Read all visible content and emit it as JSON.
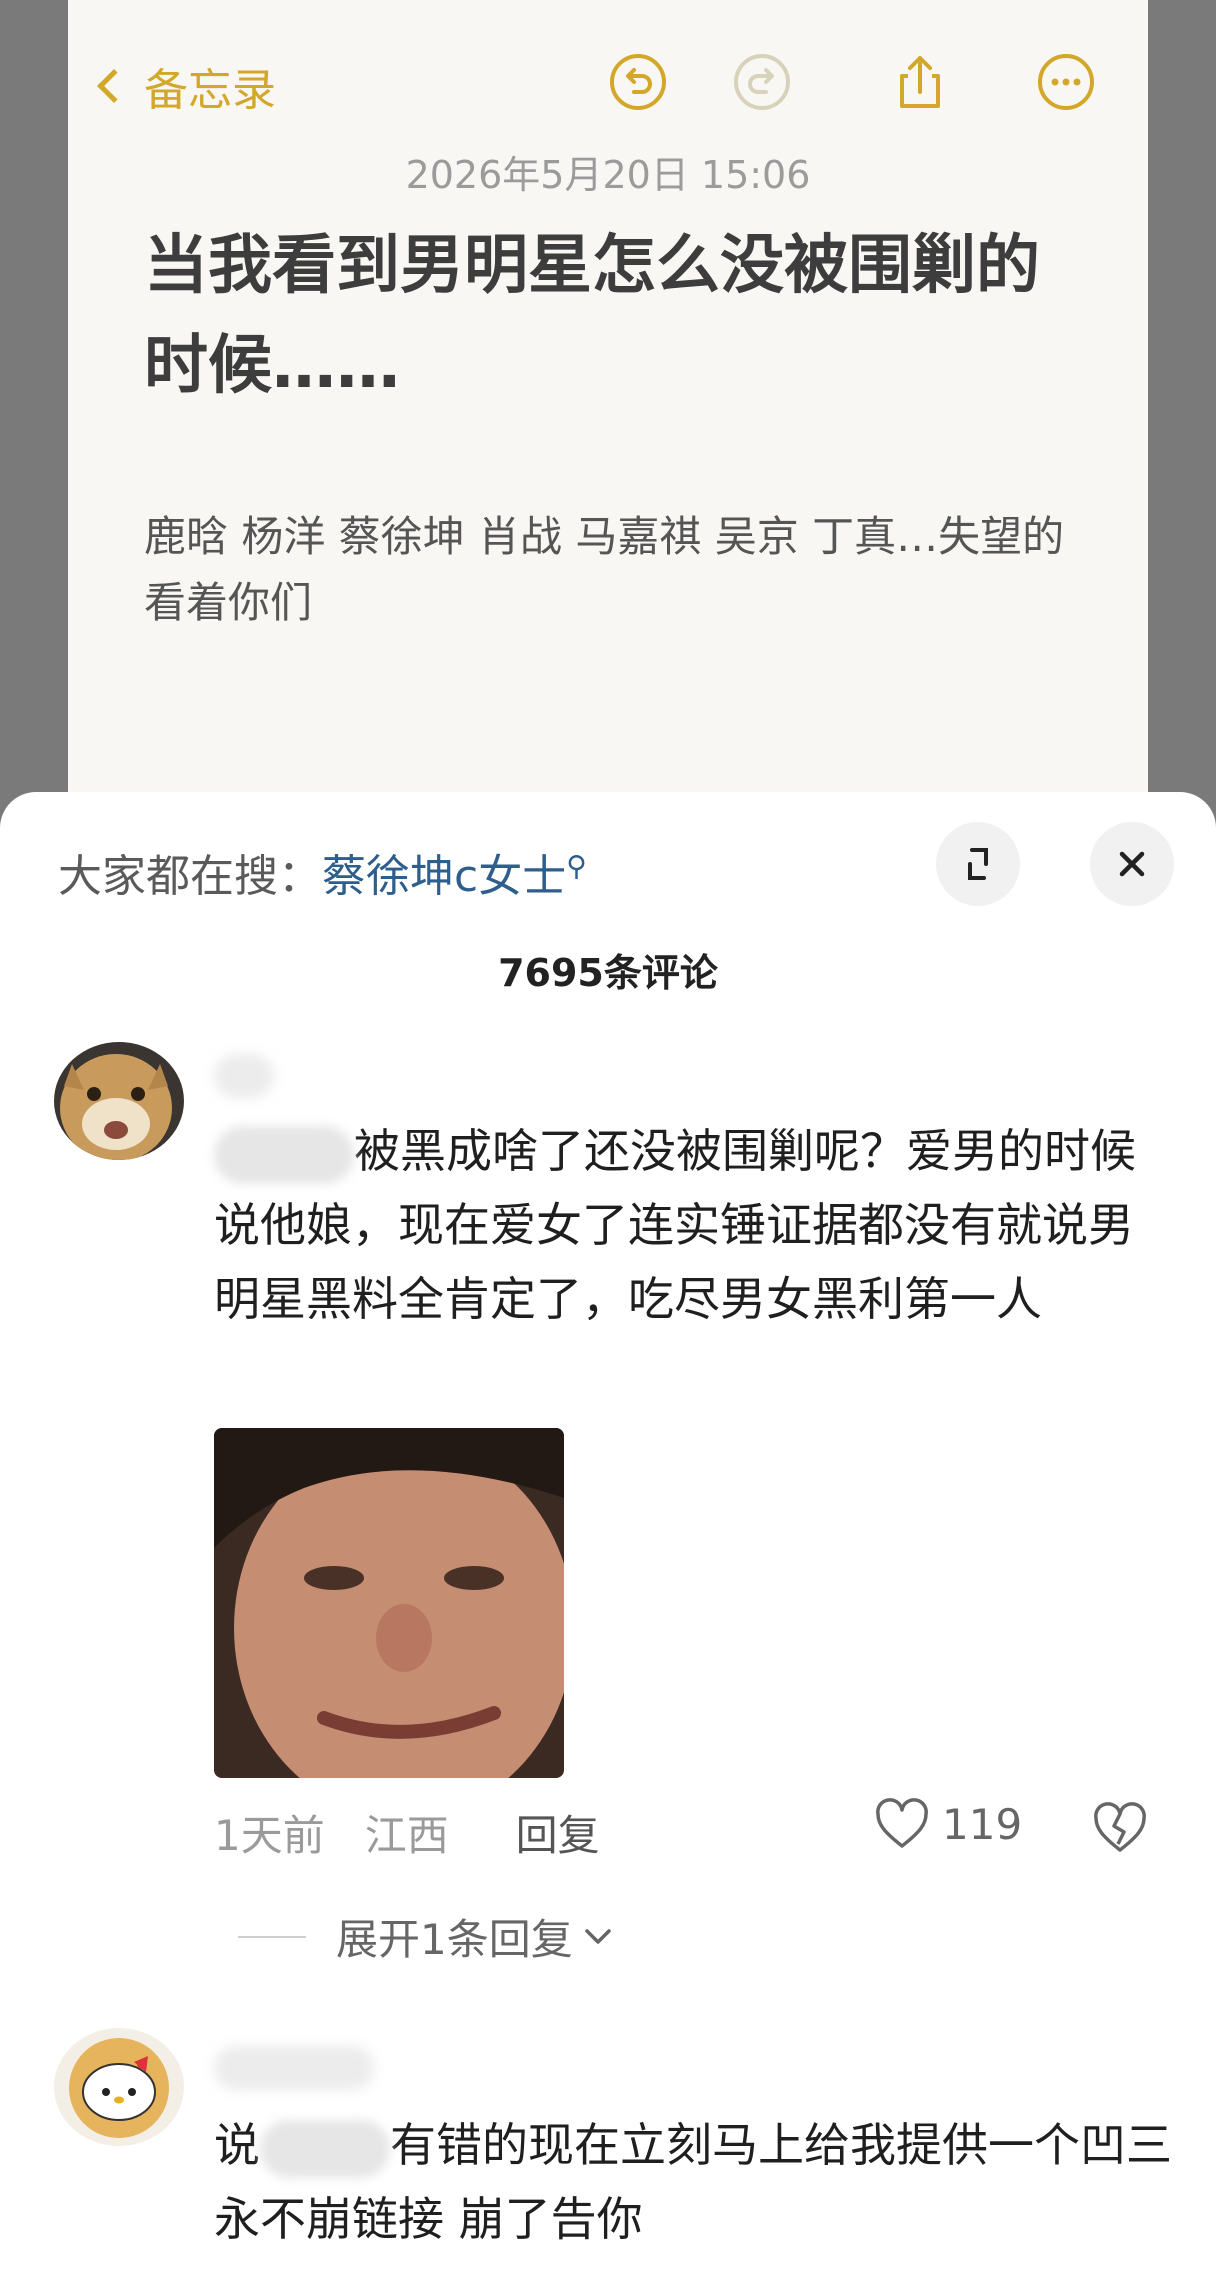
{
  "note": {
    "back_label": "备忘录",
    "date": "2026年5月20日 15:06",
    "title": "当我看到男明星怎么没被围剿的时候……",
    "body": "鹿晗 杨洋 蔡徐坤 肖战 马嘉祺 吴京 丁真…失望的看着你们",
    "accent_color": "#d3a72a",
    "icons": [
      "chevron-left-icon",
      "undo-icon",
      "redo-icon",
      "share-icon",
      "more-icon"
    ]
  },
  "sheet": {
    "hot_search_prefix": "大家都在搜：",
    "hot_search_keyword": "蔡徐坤c女士",
    "comment_count": "7695条评论",
    "icons": [
      "expand-icon",
      "close-icon"
    ]
  },
  "comments": [
    {
      "text_after_blur": "被黑成啥了还没被围剿呢？爱男的时候说他娘，现在爱女了连实锤证据都没有就说男明星黑料全肯定了，吃尽男女黑利第一人",
      "time": "1天前",
      "location": "江西",
      "reply_label": "回复",
      "likes": "119",
      "expand_replies": "展开1条回复"
    },
    {
      "text_before_blur": "说",
      "text_after_blur": "有错的现在立刻马上给我提供一个凹三永不崩链接 崩了告你"
    }
  ]
}
